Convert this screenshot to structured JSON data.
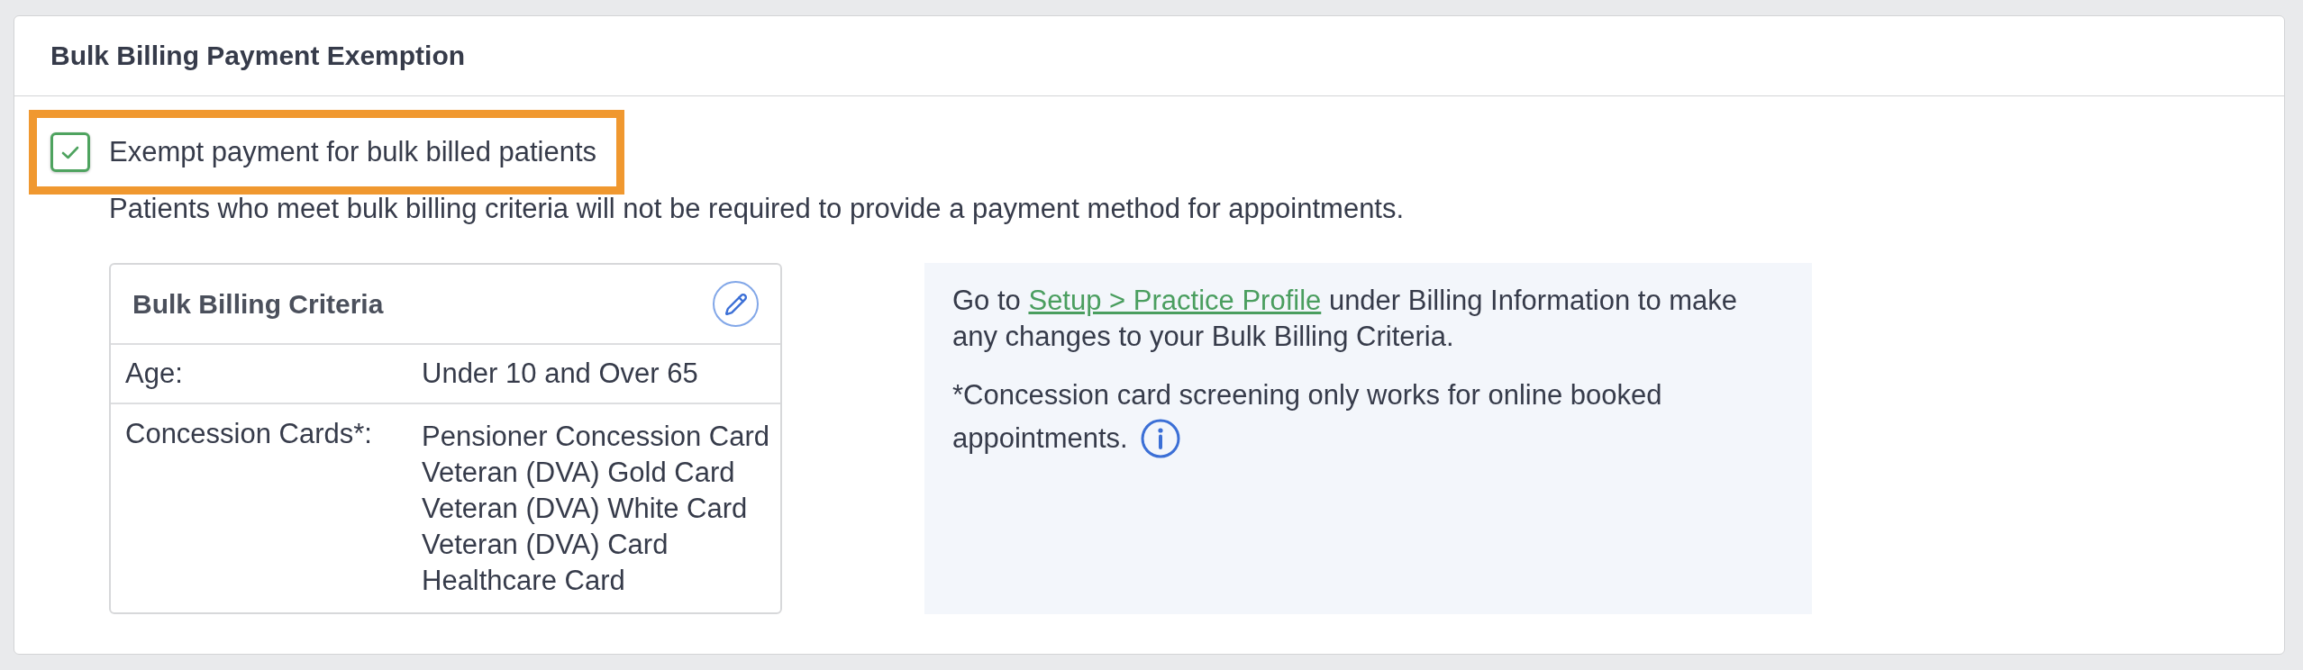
{
  "panel": {
    "title": "Bulk Billing Payment Exemption"
  },
  "exemption": {
    "label": "Exempt payment for bulk billed patients",
    "checked": true,
    "highlighted": true,
    "description": "Patients who meet bulk billing criteria will not be required to provide a payment method for appointments."
  },
  "criteria": {
    "title": "Bulk Billing Criteria",
    "rows": [
      {
        "label": "Age:",
        "values": [
          "Under 10 and Over 65"
        ]
      },
      {
        "label": "Concession Cards*:",
        "values": [
          "Pensioner Concession Card",
          "Veteran (DVA) Gold Card",
          "Veteran (DVA) White Card",
          "Veteran (DVA) Card",
          "Healthcare Card"
        ]
      }
    ]
  },
  "info": {
    "setup_note": {
      "before": "Go to",
      "link": "Setup > Practice Profile",
      "after": "under Billing Information to make any changes to your Bulk Billing Criteria."
    },
    "concession_note_lines": [
      "*Concession card screening only works for online booked",
      "appointments."
    ]
  }
}
